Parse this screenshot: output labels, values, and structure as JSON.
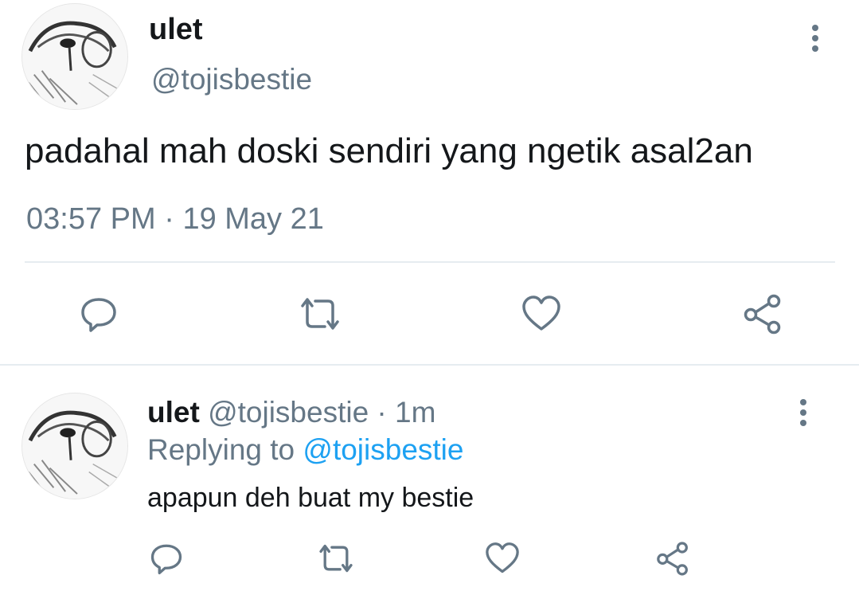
{
  "main_tweet": {
    "author_name": "ulet",
    "author_handle": "@tojisbestie",
    "text": "padahal mah doski sendiri yang ngetik asal2an",
    "time": "03:57 PM",
    "separator": " · ",
    "date": "19 May 21",
    "icons": [
      "reply-icon",
      "retweet-icon",
      "like-icon",
      "share-icon",
      "more-options-icon"
    ]
  },
  "reply_tweet": {
    "author_name": "ulet",
    "author_handle": "@tojisbestie",
    "age_separator": " · ",
    "age": "1m",
    "replying_label": "Replying to ",
    "replying_to": "@tojisbestie",
    "text": "apapun deh buat my bestie",
    "icons": [
      "reply-icon",
      "retweet-icon",
      "like-icon",
      "share-icon",
      "more-options-icon"
    ]
  },
  "colors": {
    "text_primary": "#14171a",
    "text_secondary": "#657786",
    "link": "#1da1f2",
    "divider": "#e6ecf0"
  }
}
